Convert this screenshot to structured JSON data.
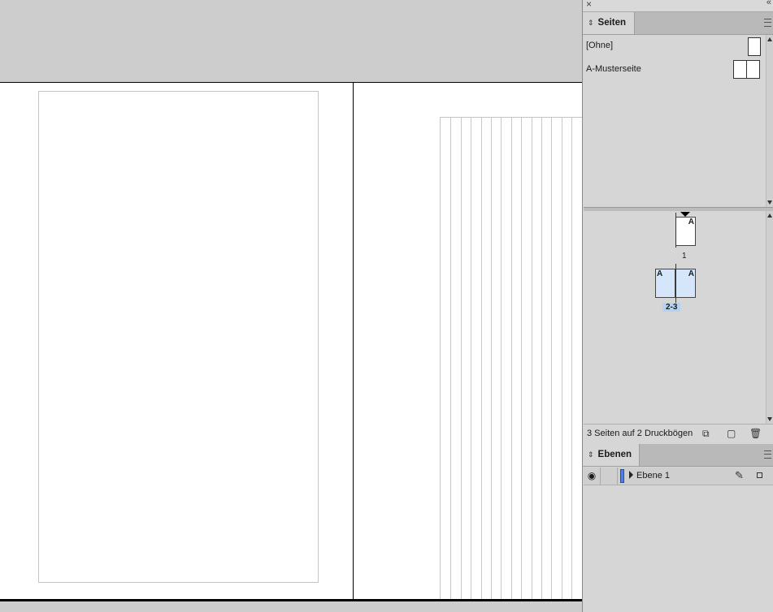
{
  "panels": {
    "pages": {
      "tab_label": "Seiten",
      "masters": [
        {
          "label": "[Ohne]"
        },
        {
          "label": "A-Musterseite"
        }
      ],
      "pages": [
        {
          "number": "1",
          "prefix": "A"
        },
        {
          "number": "2-3",
          "prefixes": [
            "A",
            "A"
          ],
          "selected": true
        }
      ],
      "footer_status": "3 Seiten auf 2 Druckbögen"
    },
    "layers": {
      "tab_label": "Ebenen",
      "rows": [
        {
          "name": "Ebene 1",
          "visible": true,
          "color": "#4f7fe0"
        }
      ]
    }
  },
  "icons": {
    "panel_close": "×",
    "panel_collapse": "«",
    "tab_toggle": "⌃⌄",
    "eye": "◉",
    "pen": "✎",
    "new_page": "▢",
    "edit_page_size": "⧉",
    "delete": "🗑"
  },
  "document": {
    "column_guide_count": 14
  }
}
